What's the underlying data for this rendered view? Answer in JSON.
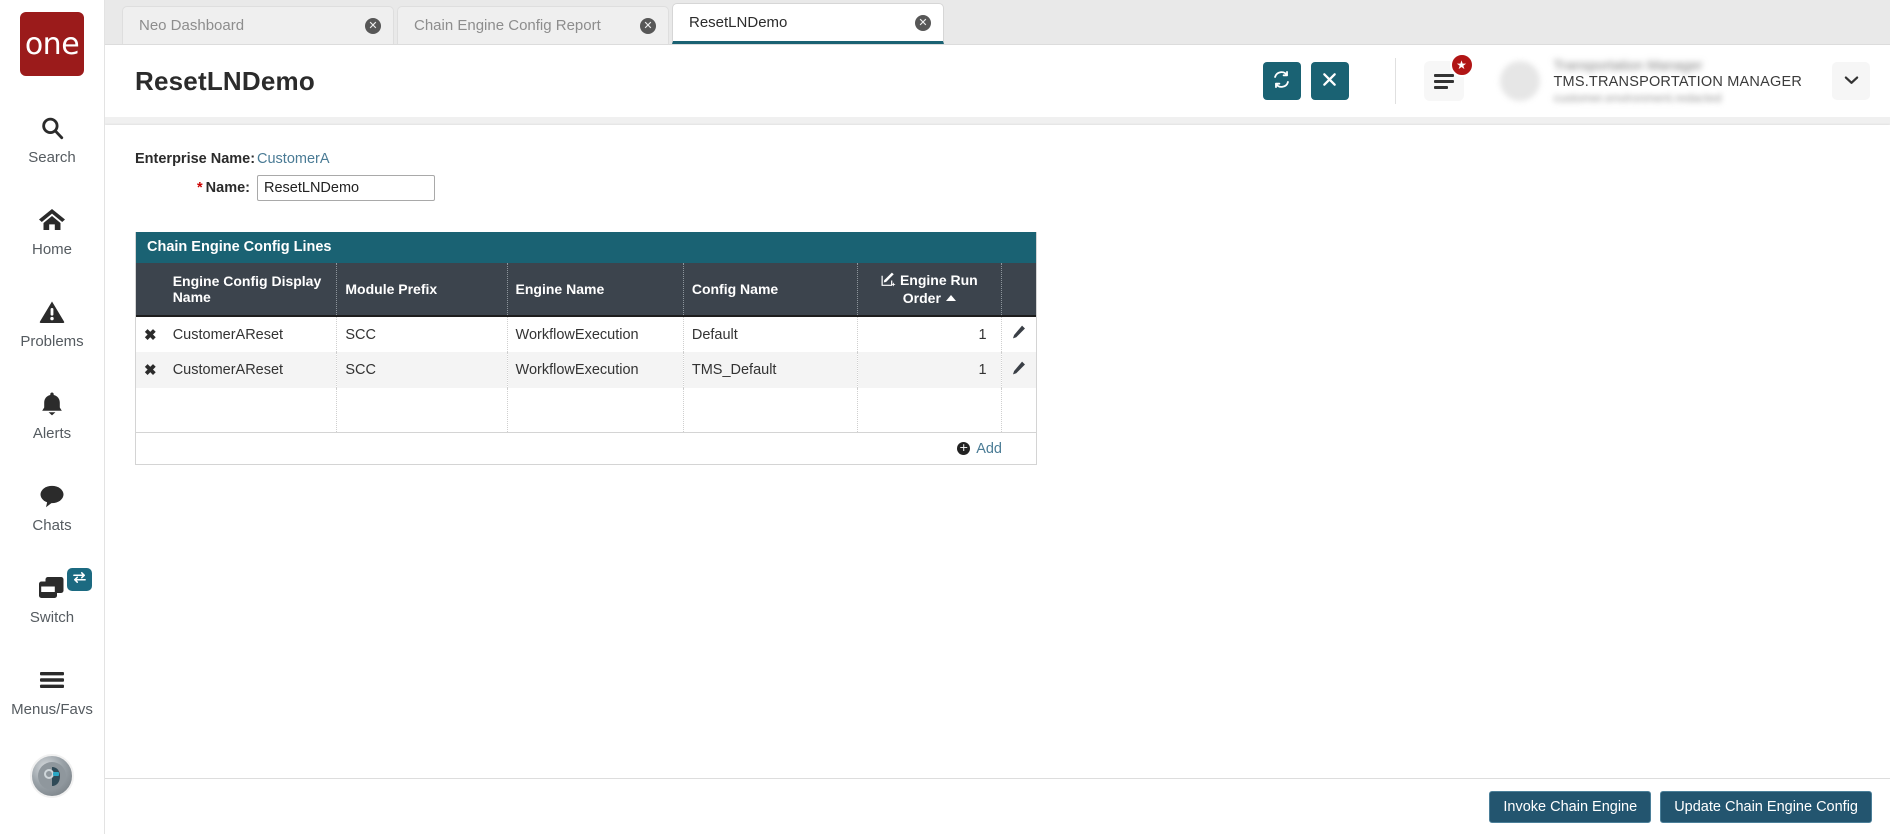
{
  "brand": {
    "logo_text": "one",
    "logo_color": "#9B1B1B"
  },
  "theme": {
    "teal": "#1A6273",
    "dark_header": "#3C444D",
    "link": "#4A7B95",
    "button": "#23556F",
    "badge_red": "#B11515"
  },
  "sidebar": {
    "items": [
      {
        "icon": "search-icon",
        "label": "Search"
      },
      {
        "icon": "home-icon",
        "label": "Home"
      },
      {
        "icon": "warning-triangle-icon",
        "label": "Problems"
      },
      {
        "icon": "bell-icon",
        "label": "Alerts"
      },
      {
        "icon": "chat-bubble-icon",
        "label": "Chats"
      },
      {
        "icon": "switch-windows-icon",
        "label": "Switch",
        "badge_icon": "swap-arrows-icon"
      },
      {
        "icon": "hamburger-icon",
        "label": "Menus/Favs"
      }
    ],
    "assistant": {
      "name": "ai-assistant-avatar"
    }
  },
  "tabs": [
    {
      "label": "Neo Dashboard",
      "active": false,
      "close_icon": "close-circle-icon"
    },
    {
      "label": "Chain Engine Config Report",
      "active": false,
      "close_icon": "close-circle-icon"
    },
    {
      "label": "ResetLNDemo",
      "active": true,
      "close_icon": "close-circle-icon"
    }
  ],
  "header": {
    "title": "ResetLNDemo",
    "refresh_icon": "refresh-sync-icon",
    "close_icon": "close-x-icon",
    "menu_icon": "list-menu-icon",
    "menu_badge_icon": "star-icon",
    "user_login": "TMS.TRANSPORTATION  MANAGER",
    "user_caret_icon": "chevron-down-icon"
  },
  "form": {
    "enterprise_label": "Enterprise Name:",
    "enterprise_value": "CustomerA",
    "name_label": "Name:",
    "name_required_mark": "*",
    "name_value": "ResetLNDemo",
    "name_placeholder": ""
  },
  "grid": {
    "title": "Chain Engine Config Lines",
    "columns": [
      {
        "key": "delete",
        "label": ""
      },
      {
        "key": "display_name",
        "label": "Engine Config Display Name"
      },
      {
        "key": "module_prefix",
        "label": "Module Prefix"
      },
      {
        "key": "engine_name",
        "label": "Engine Name"
      },
      {
        "key": "config_name",
        "label": "Config Name"
      },
      {
        "key": "run_order",
        "label": "Engine Run Order",
        "icon": "editable-column-icon",
        "sort": "asc"
      },
      {
        "key": "edit",
        "label": ""
      }
    ],
    "rows": [
      {
        "delete_icon": "delete-x-icon",
        "display_name": "CustomerAReset",
        "module_prefix": "SCC",
        "engine_name": "WorkflowExecution",
        "config_name": "Default",
        "run_order": "1",
        "edit_icon": "pencil-edit-icon"
      },
      {
        "delete_icon": "delete-x-icon",
        "display_name": "CustomerAReset",
        "module_prefix": "SCC",
        "engine_name": "WorkflowExecution",
        "config_name": "TMS_Default",
        "run_order": "1",
        "edit_icon": "pencil-edit-icon"
      }
    ],
    "add_label": "Add",
    "add_icon": "plus-circle-icon"
  },
  "footer": {
    "invoke_label": "Invoke Chain Engine",
    "update_label": "Update Chain Engine Config"
  }
}
